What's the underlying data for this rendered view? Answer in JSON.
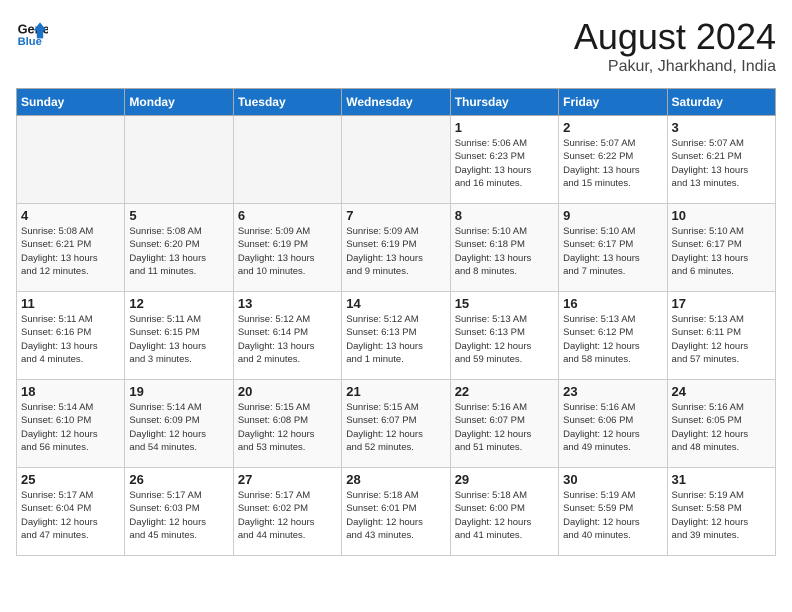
{
  "header": {
    "logo_line1": "General",
    "logo_line2": "Blue",
    "title": "August 2024",
    "subtitle": "Pakur, Jharkhand, India"
  },
  "weekdays": [
    "Sunday",
    "Monday",
    "Tuesday",
    "Wednesday",
    "Thursday",
    "Friday",
    "Saturday"
  ],
  "weeks": [
    [
      {
        "day": "",
        "info": "",
        "empty": true
      },
      {
        "day": "",
        "info": "",
        "empty": true
      },
      {
        "day": "",
        "info": "",
        "empty": true
      },
      {
        "day": "",
        "info": "",
        "empty": true
      },
      {
        "day": "1",
        "info": "Sunrise: 5:06 AM\nSunset: 6:23 PM\nDaylight: 13 hours\nand 16 minutes."
      },
      {
        "day": "2",
        "info": "Sunrise: 5:07 AM\nSunset: 6:22 PM\nDaylight: 13 hours\nand 15 minutes."
      },
      {
        "day": "3",
        "info": "Sunrise: 5:07 AM\nSunset: 6:21 PM\nDaylight: 13 hours\nand 13 minutes."
      }
    ],
    [
      {
        "day": "4",
        "info": "Sunrise: 5:08 AM\nSunset: 6:21 PM\nDaylight: 13 hours\nand 12 minutes."
      },
      {
        "day": "5",
        "info": "Sunrise: 5:08 AM\nSunset: 6:20 PM\nDaylight: 13 hours\nand 11 minutes."
      },
      {
        "day": "6",
        "info": "Sunrise: 5:09 AM\nSunset: 6:19 PM\nDaylight: 13 hours\nand 10 minutes."
      },
      {
        "day": "7",
        "info": "Sunrise: 5:09 AM\nSunset: 6:19 PM\nDaylight: 13 hours\nand 9 minutes."
      },
      {
        "day": "8",
        "info": "Sunrise: 5:10 AM\nSunset: 6:18 PM\nDaylight: 13 hours\nand 8 minutes."
      },
      {
        "day": "9",
        "info": "Sunrise: 5:10 AM\nSunset: 6:17 PM\nDaylight: 13 hours\nand 7 minutes."
      },
      {
        "day": "10",
        "info": "Sunrise: 5:10 AM\nSunset: 6:17 PM\nDaylight: 13 hours\nand 6 minutes."
      }
    ],
    [
      {
        "day": "11",
        "info": "Sunrise: 5:11 AM\nSunset: 6:16 PM\nDaylight: 13 hours\nand 4 minutes."
      },
      {
        "day": "12",
        "info": "Sunrise: 5:11 AM\nSunset: 6:15 PM\nDaylight: 13 hours\nand 3 minutes."
      },
      {
        "day": "13",
        "info": "Sunrise: 5:12 AM\nSunset: 6:14 PM\nDaylight: 13 hours\nand 2 minutes."
      },
      {
        "day": "14",
        "info": "Sunrise: 5:12 AM\nSunset: 6:13 PM\nDaylight: 13 hours\nand 1 minute."
      },
      {
        "day": "15",
        "info": "Sunrise: 5:13 AM\nSunset: 6:13 PM\nDaylight: 12 hours\nand 59 minutes."
      },
      {
        "day": "16",
        "info": "Sunrise: 5:13 AM\nSunset: 6:12 PM\nDaylight: 12 hours\nand 58 minutes."
      },
      {
        "day": "17",
        "info": "Sunrise: 5:13 AM\nSunset: 6:11 PM\nDaylight: 12 hours\nand 57 minutes."
      }
    ],
    [
      {
        "day": "18",
        "info": "Sunrise: 5:14 AM\nSunset: 6:10 PM\nDaylight: 12 hours\nand 56 minutes."
      },
      {
        "day": "19",
        "info": "Sunrise: 5:14 AM\nSunset: 6:09 PM\nDaylight: 12 hours\nand 54 minutes."
      },
      {
        "day": "20",
        "info": "Sunrise: 5:15 AM\nSunset: 6:08 PM\nDaylight: 12 hours\nand 53 minutes."
      },
      {
        "day": "21",
        "info": "Sunrise: 5:15 AM\nSunset: 6:07 PM\nDaylight: 12 hours\nand 52 minutes."
      },
      {
        "day": "22",
        "info": "Sunrise: 5:16 AM\nSunset: 6:07 PM\nDaylight: 12 hours\nand 51 minutes."
      },
      {
        "day": "23",
        "info": "Sunrise: 5:16 AM\nSunset: 6:06 PM\nDaylight: 12 hours\nand 49 minutes."
      },
      {
        "day": "24",
        "info": "Sunrise: 5:16 AM\nSunset: 6:05 PM\nDaylight: 12 hours\nand 48 minutes."
      }
    ],
    [
      {
        "day": "25",
        "info": "Sunrise: 5:17 AM\nSunset: 6:04 PM\nDaylight: 12 hours\nand 47 minutes."
      },
      {
        "day": "26",
        "info": "Sunrise: 5:17 AM\nSunset: 6:03 PM\nDaylight: 12 hours\nand 45 minutes."
      },
      {
        "day": "27",
        "info": "Sunrise: 5:17 AM\nSunset: 6:02 PM\nDaylight: 12 hours\nand 44 minutes."
      },
      {
        "day": "28",
        "info": "Sunrise: 5:18 AM\nSunset: 6:01 PM\nDaylight: 12 hours\nand 43 minutes."
      },
      {
        "day": "29",
        "info": "Sunrise: 5:18 AM\nSunset: 6:00 PM\nDaylight: 12 hours\nand 41 minutes."
      },
      {
        "day": "30",
        "info": "Sunrise: 5:19 AM\nSunset: 5:59 PM\nDaylight: 12 hours\nand 40 minutes."
      },
      {
        "day": "31",
        "info": "Sunrise: 5:19 AM\nSunset: 5:58 PM\nDaylight: 12 hours\nand 39 minutes."
      }
    ]
  ]
}
